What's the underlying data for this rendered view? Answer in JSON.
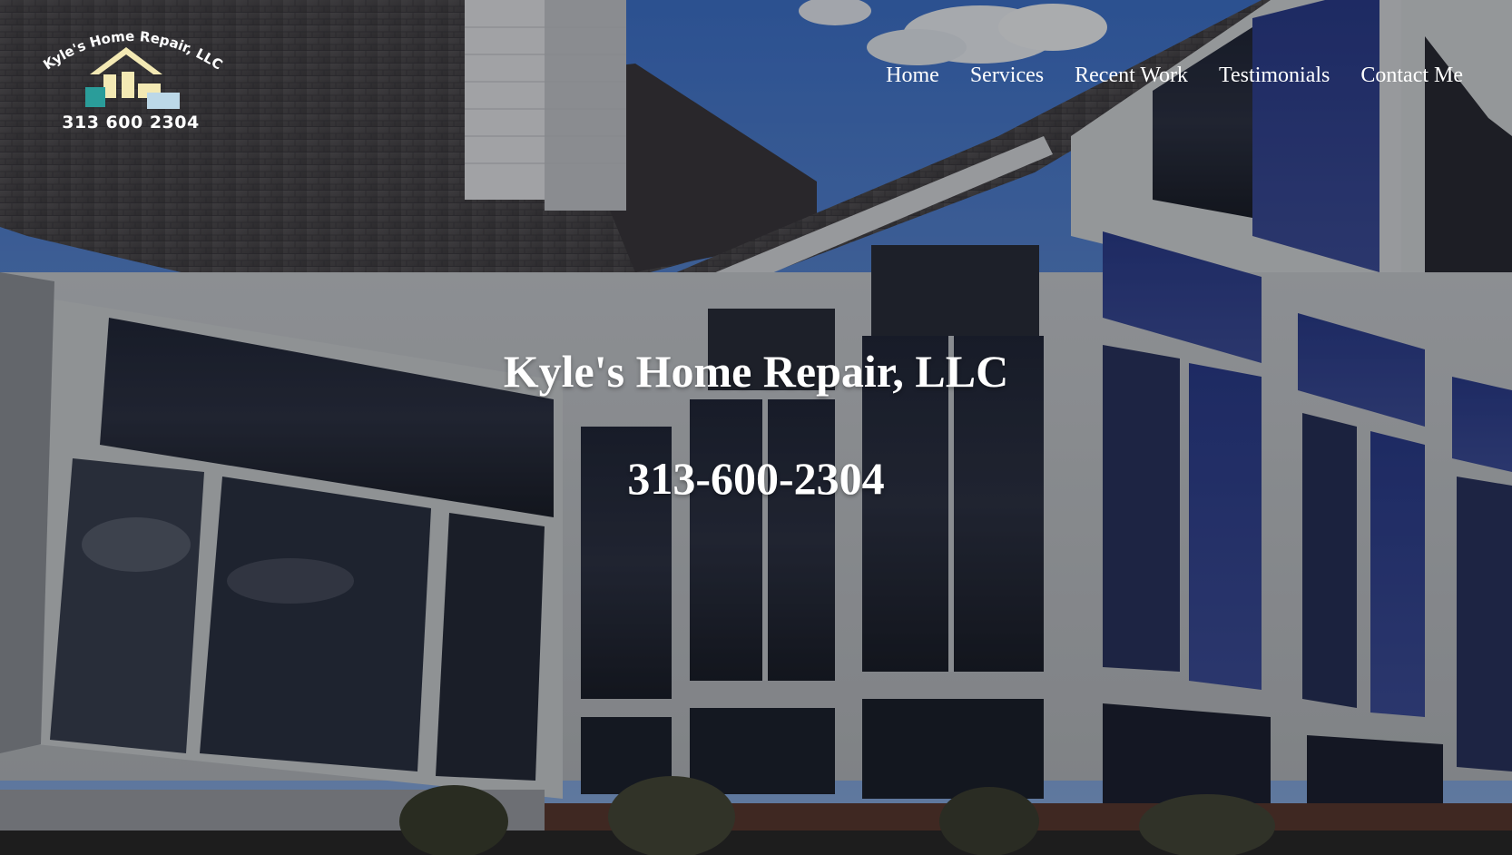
{
  "logo": {
    "arc_text": "Kyle's Home Repair, LLC",
    "phone": "313 600 2304"
  },
  "nav": {
    "items": [
      {
        "label": "Home"
      },
      {
        "label": "Services"
      },
      {
        "label": "Recent Work"
      },
      {
        "label": "Testimonials"
      },
      {
        "label": "Contact Me"
      }
    ]
  },
  "hero": {
    "title": "Kyle's Home Repair, LLC",
    "phone": "313-600-2304"
  },
  "colors": {
    "text": "#ffffff",
    "logo_house_cream": "#f3e9b4",
    "logo_teal": "#2a9d9a",
    "logo_sky": "#bcd8e8",
    "sky_blue": "#4a78c8"
  }
}
